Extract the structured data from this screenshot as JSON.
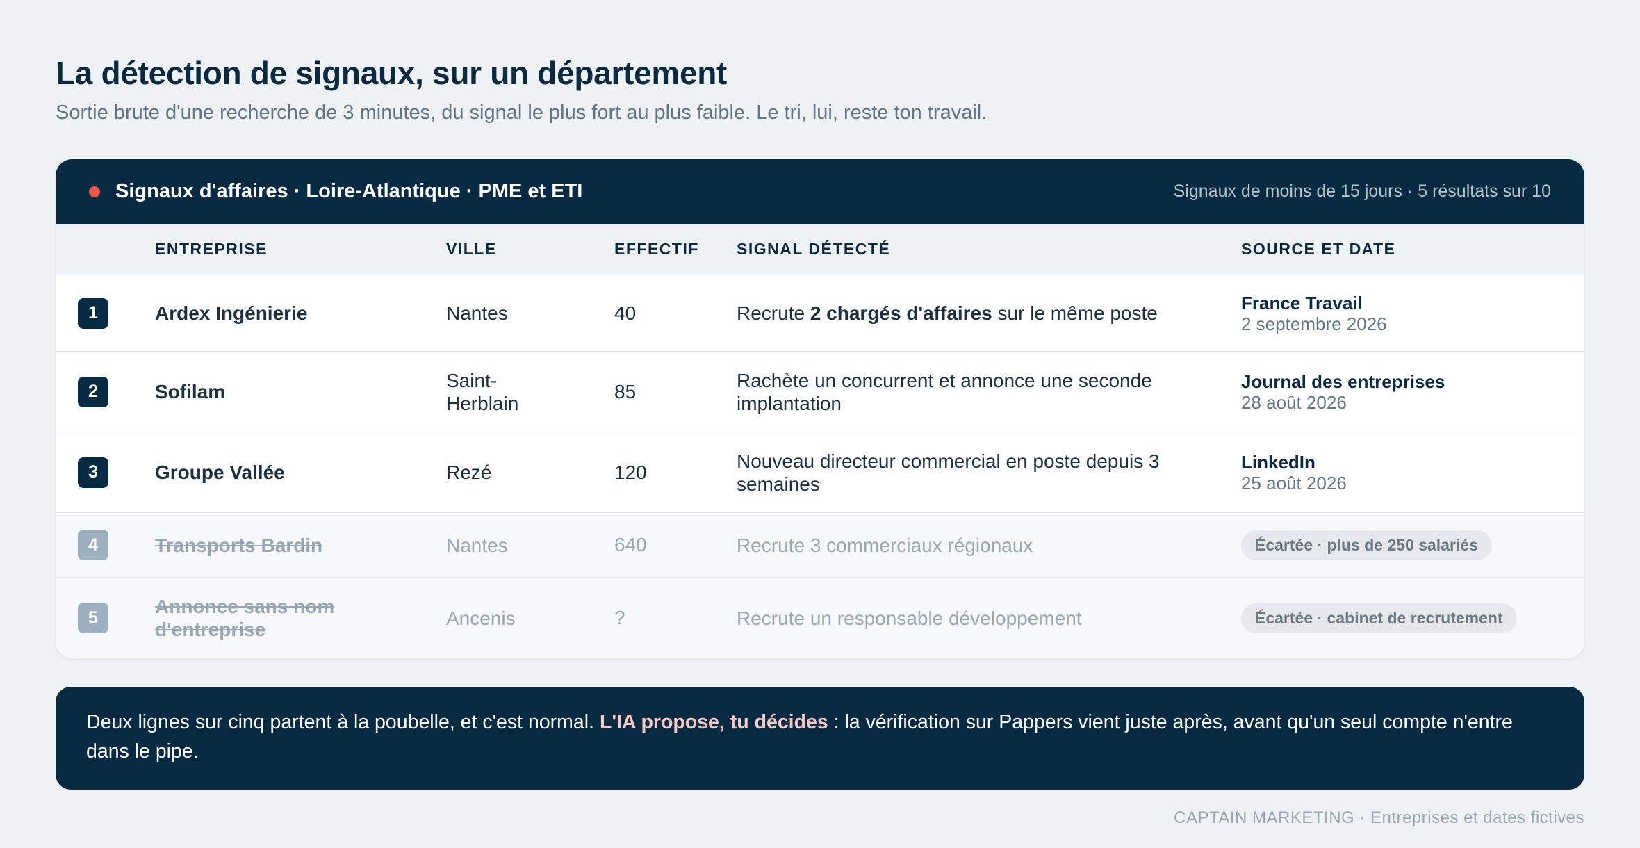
{
  "page": {
    "title": "La détection de signaux, sur un département",
    "subtitle": "Sortie brute d'une recherche de 3 minutes, du signal le plus fort au plus faible. Le tri, lui, reste ton travail."
  },
  "panel": {
    "title": "Signaux d'affaires · Loire-Atlantique · PME et ETI",
    "meta": "Signaux de moins de 15 jours · 5 résultats sur 10",
    "dot_color": "#ec5a4f"
  },
  "columns": {
    "entreprise": "ENTREPRISE",
    "ville": "VILLE",
    "effectif": "EFFECTIF",
    "signal": "SIGNAL DÉTECTÉ",
    "source": "SOURCE ET DATE"
  },
  "rows": [
    {
      "num": "1",
      "entreprise": "Ardex Ingénierie",
      "ville": "Nantes",
      "effectif": "40",
      "signal_pre": "Recrute ",
      "signal_bold": "2 chargés d'affaires",
      "signal_post": " sur le même poste",
      "source_name": "France Travail",
      "source_date": "2 septembre 2026"
    },
    {
      "num": "2",
      "entreprise": "Sofilam",
      "ville": "Saint-Herblain",
      "effectif": "85",
      "signal": "Rachète un concurrent et annonce une seconde implantation",
      "source_name": "Journal des entreprises",
      "source_date": "28 août 2026"
    },
    {
      "num": "3",
      "entreprise": "Groupe Vallée",
      "ville": "Rezé",
      "effectif": "120",
      "signal": "Nouveau directeur commercial en poste depuis 3 semaines",
      "source_name": "LinkedIn",
      "source_date": "25 août 2026"
    },
    {
      "num": "4",
      "entreprise": "Transports Bardin",
      "ville": "Nantes",
      "effectif": "640",
      "signal": "Recrute 3 commerciaux régionaux",
      "status": "Écartée · plus de 250 salariés"
    },
    {
      "num": "5",
      "entreprise": "Annonce sans nom d'entreprise",
      "ville": "Ancenis",
      "effectif": "?",
      "signal": "Recrute un responsable développement",
      "status": "Écartée · cabinet de recrutement"
    }
  ],
  "note": {
    "pre": "Deux lignes sur cinq partent à la poubelle, et c'est normal. ",
    "em": "L'IA propose, tu décides",
    "post": " : la vérification sur Pappers vient juste après, avant qu'un seul compte n'entre dans le pipe."
  },
  "footer": "CAPTAIN MARKETING · Entreprises et dates fictives",
  "colors": {
    "navy": "#062a42",
    "background": "#eef2f5",
    "accent_red": "#ec5a4f",
    "highlight_pink": "#f7c8c6"
  }
}
